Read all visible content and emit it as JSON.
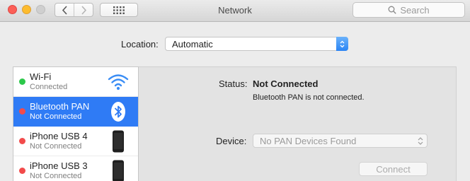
{
  "window": {
    "title": "Network"
  },
  "toolbar": {
    "search_placeholder": "Search"
  },
  "location": {
    "label": "Location:",
    "value": "Automatic"
  },
  "services": [
    {
      "name": "Wi-Fi",
      "status": "Connected",
      "status_color": "#2cc84a",
      "icon": "wifi-icon",
      "selected": false
    },
    {
      "name": "Bluetooth PAN",
      "status": "Not Connected",
      "status_color": "#f24b4b",
      "icon": "bluetooth-icon",
      "selected": true
    },
    {
      "name": "iPhone USB 4",
      "status": "Not Connected",
      "status_color": "#f24b4b",
      "icon": "iphone-icon",
      "selected": false
    },
    {
      "name": "iPhone USB 3",
      "status": "Not Connected",
      "status_color": "#f24b4b",
      "icon": "iphone-icon",
      "selected": false
    }
  ],
  "detail": {
    "status_label": "Status:",
    "status_value": "Not Connected",
    "status_description": "Bluetooth PAN is not connected.",
    "device_label": "Device:",
    "device_value": "No PAN Devices Found",
    "connect_label": "Connect"
  },
  "colors": {
    "selection": "#2f7bf5",
    "accent": "#2a84f4"
  }
}
